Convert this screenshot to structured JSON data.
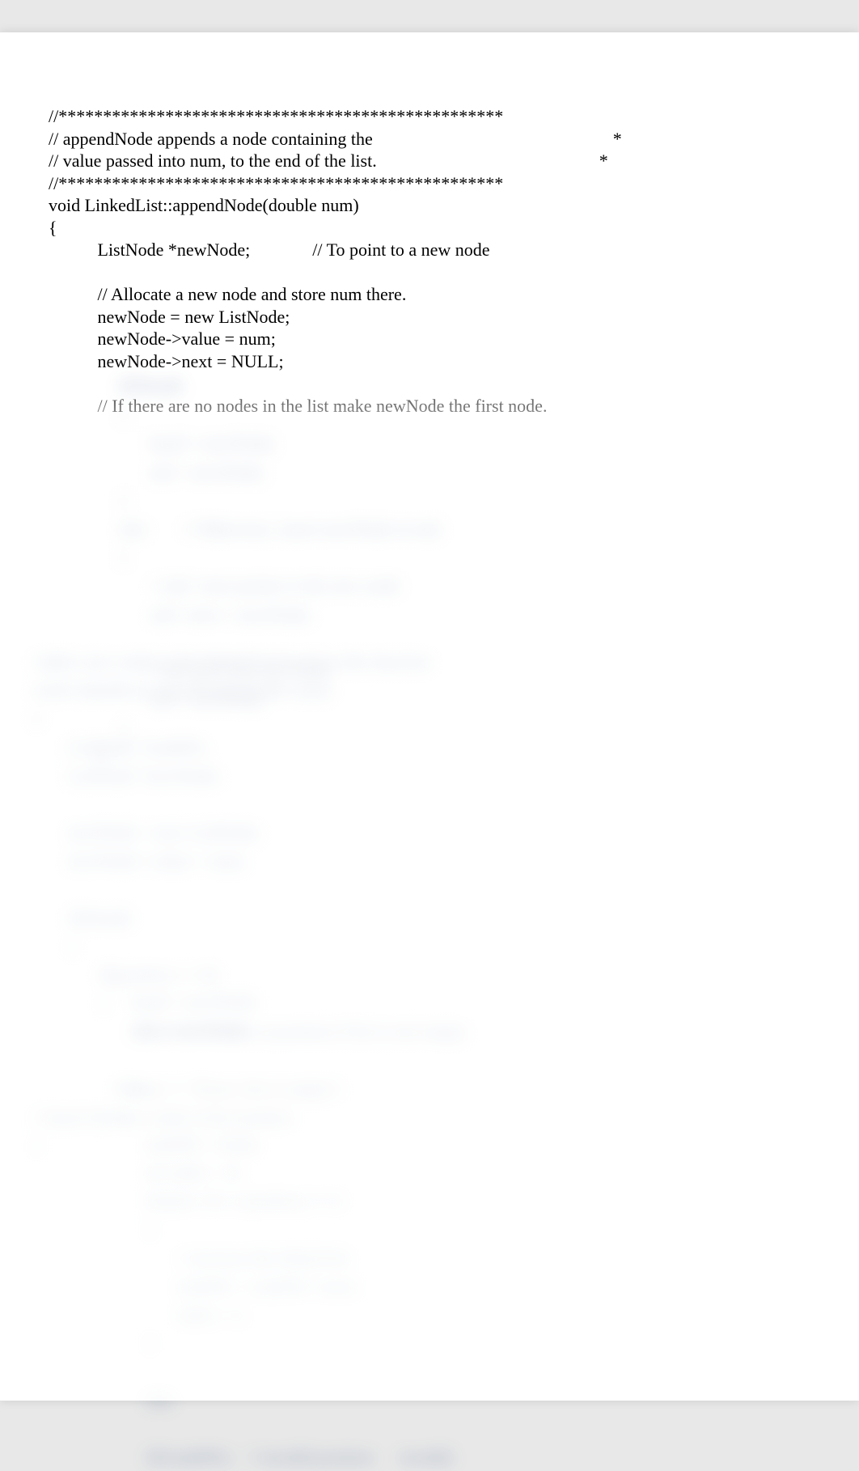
{
  "code": {
    "lines": [
      "//**************************************************",
      "// appendNode appends a node containing the                                                      *",
      "// value passed into num, to the end of the list.                                                  *",
      "//**************************************************",
      "void LinkedList::appendNode(double num)",
      "{",
      "           ListNode *newNode;              // To point to a new node",
      "",
      "           // Allocate a new node and store num there.",
      "           newNode = new ListNode;",
      "           newNode->value = num;",
      "           newNode->next = NULL;",
      "",
      "           // If there are no nodes in the list make newNode the first node."
    ]
  },
  "obscured": {
    "block1": "     if(!head)\n     {\n            head = newNode;\n            tail = newNode;\n     }\n     else        // Otherwise, insert newNode at end.\n     {\n            // tail->next points to the new node\n            tail->next = newNode;\n\n            // the tail is the new node\n            tail = newNode;\n     }\n}",
    "block2": "//add a new node to the linked list based on the function\nvoid LinkedList::insertNode(double num)\n{\n        ListNode *nodePtr;\n        ListNode *newNode;\n\n        newNode = new ListNode;\n        newNode->value = num;\n\n        if(!head)\n        {\n               if(position == 0)\n               {\n                      //Insert newNode at position if list is not empty\n\n                      cout << \"Error: list is empty\";\n// Insert the new node at the position\n}",
    "block3": "        head = newNode;\n        tail = newNode;\n\n    else\n    {\n           nodePtr = head;\n           int index = 0;\n           for(int i=0; i<position; i++)\n           {\n                  // traverse the linked list\n                  nodePtr = nodePtr->next;\n                  index = i;\n           }\n\n           else\n\n           if(!nodePtr)    // invalid position      invalid;"
  }
}
